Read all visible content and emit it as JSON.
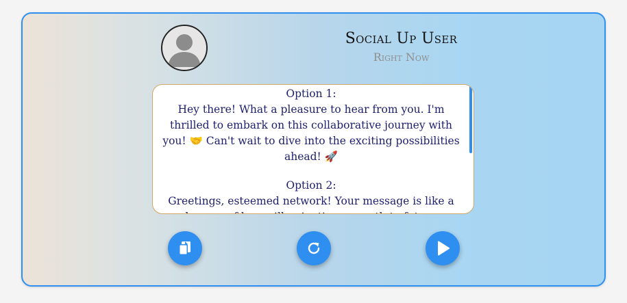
{
  "profile": {
    "name": "Social Up User",
    "time": "Right Now"
  },
  "message": {
    "option1_label": "Option 1:",
    "option1_text": "Hey there! What a pleasure to hear from you. I'm thrilled to embark on this collaborative journey with you! 🤝 Can't wait to dive into the exciting possibilities ahead! 🚀",
    "option2_label": "Option 2:",
    "option2_text": "Greetings, esteemed network! Your message is like a beacon of hope, illuminating my path to future collaborations. I eagerly anticipate the road ahead and what awaits us! 🌸"
  },
  "actions": {
    "copy_icon": "copy-icon",
    "refresh_icon": "refresh-icon",
    "send_icon": "play-icon"
  },
  "colors": {
    "accent": "#2e8ff0",
    "message_text": "#1d1f6e",
    "message_border": "#d2a663"
  }
}
